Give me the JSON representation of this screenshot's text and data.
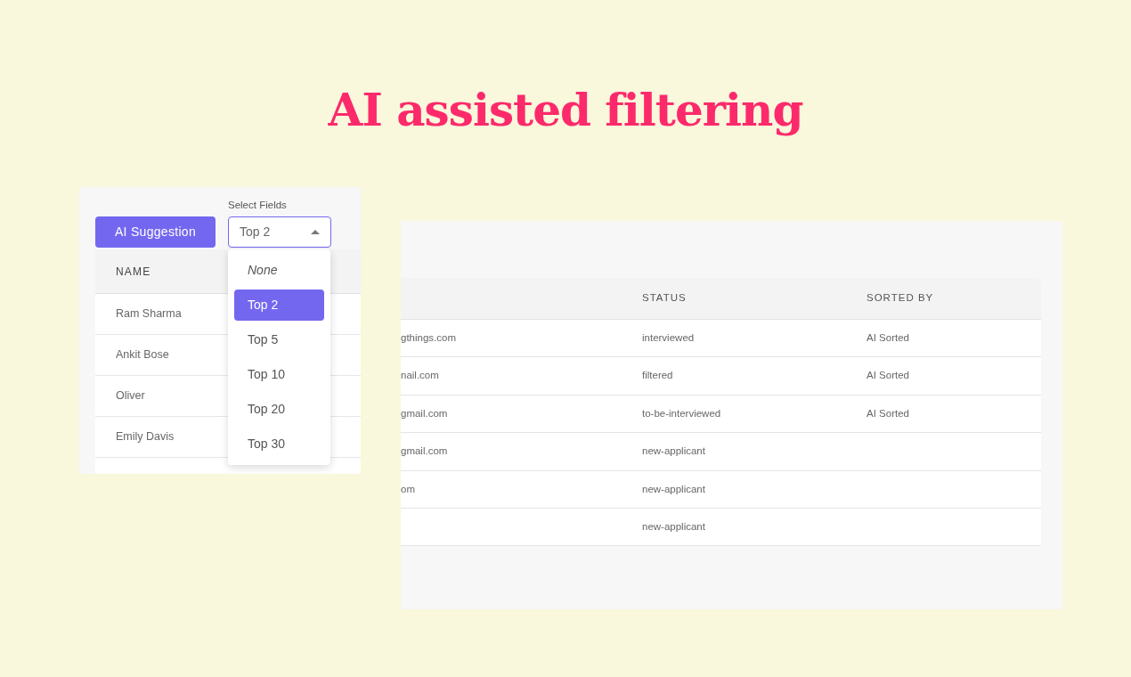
{
  "title": "AI assisted filtering",
  "left_panel": {
    "button": "AI Suggestion",
    "select": {
      "label": "Select Fields",
      "value": "Top 2",
      "expanded": true,
      "options": [
        {
          "label": "None",
          "kind": "empty",
          "selected": false
        },
        {
          "label": "Top 2",
          "kind": "value",
          "selected": true
        },
        {
          "label": "Top 5",
          "kind": "value",
          "selected": false
        },
        {
          "label": "Top 10",
          "kind": "value",
          "selected": false
        },
        {
          "label": "Top 20",
          "kind": "value",
          "selected": false
        },
        {
          "label": "Top 30",
          "kind": "value",
          "selected": false
        }
      ]
    },
    "table": {
      "columns": [
        "NAME"
      ],
      "rows": [
        "Ram Sharma",
        "Ankit Bose",
        "Oliver",
        "Emily Davis"
      ]
    }
  },
  "right_panel": {
    "table": {
      "columns": [
        "STATUS",
        "SORTED BY"
      ],
      "rows": [
        {
          "column_1": "gthings.com",
          "status": "interviewed",
          "sorted_by": "AI Sorted"
        },
        {
          "column_1": "nail.com",
          "status": "filtered",
          "sorted_by": "AI Sorted"
        },
        {
          "column_1": "gmail.com",
          "status": "to-be-interviewed",
          "sorted_by": "AI Sorted"
        },
        {
          "column_1": "gmail.com",
          "status": "new-applicant"
        },
        {
          "column_1": "om",
          "status": "new-applicant"
        },
        {
          "status": "new-applicant"
        }
      ]
    }
  }
}
